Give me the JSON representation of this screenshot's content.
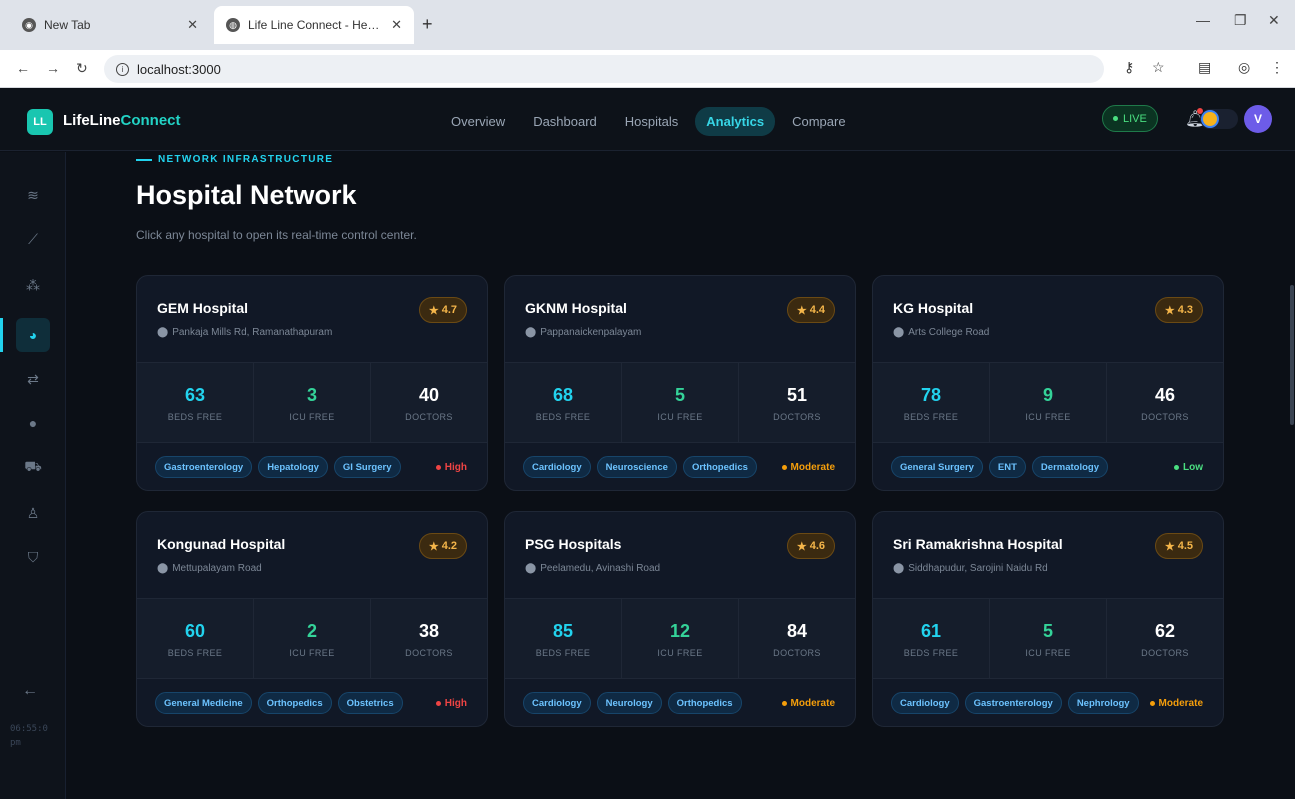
{
  "browser": {
    "tabs": [
      {
        "title": "New Tab",
        "active": false
      },
      {
        "title": "Life Line Connect - Healthcare I",
        "active": true
      }
    ],
    "url": "localhost:3000"
  },
  "app": {
    "logo_text": "LL",
    "brand_main": "LifeLine",
    "brand_accent": "Connect",
    "nav": [
      {
        "label": "Overview",
        "active": false
      },
      {
        "label": "Dashboard",
        "active": false
      },
      {
        "label": "Hospitals",
        "active": false
      },
      {
        "label": "Analytics",
        "active": true
      },
      {
        "label": "Compare",
        "active": false
      }
    ],
    "live_label": "LIVE",
    "avatar_initial": "V",
    "accent_color": "#22d3ee"
  },
  "sidebar": {
    "items": [
      {
        "icon": "layers-icon",
        "glyph": "≋",
        "active": false
      },
      {
        "icon": "trend-chart-icon",
        "glyph": "⟋",
        "active": false
      },
      {
        "icon": "people-group-icon",
        "glyph": "⁂",
        "active": false
      },
      {
        "icon": "pie-chart-icon",
        "glyph": "◕",
        "active": true
      },
      {
        "icon": "compare-arrows-icon",
        "glyph": "⇄",
        "active": false
      },
      {
        "icon": "blood-drop-icon",
        "glyph": "●",
        "active": false
      },
      {
        "icon": "ambulance-icon",
        "glyph": "⛟",
        "active": false
      },
      {
        "icon": "doctor-icon",
        "glyph": "♙",
        "active": false
      },
      {
        "icon": "shield-icon",
        "glyph": "⛉",
        "active": false
      }
    ],
    "clock_text": "06:55:0 pm"
  },
  "page": {
    "eyebrow": "NETWORK INFRASTRUCTURE",
    "title": "Hospital Network",
    "subtitle": "Click any hospital to open its real-time control center."
  },
  "labels": {
    "beds": "BEDS FREE",
    "icu": "ICU FREE",
    "doctors": "DOCTORS"
  },
  "load_colors": {
    "High": "#ef4444",
    "Moderate": "#f59e0b",
    "Low": "#4ade80"
  },
  "hospitals": [
    {
      "name": "GEM Hospital",
      "address": "Pankaja Mills Rd, Ramanathapuram",
      "rating": "4.7",
      "beds": "63",
      "icu": "3",
      "doctors": "40",
      "tags": [
        "Gastroenterology",
        "Hepatology",
        "GI Surgery"
      ],
      "load": "High"
    },
    {
      "name": "GKNM Hospital",
      "address": "Pappanaickenpalayam",
      "rating": "4.4",
      "beds": "68",
      "icu": "5",
      "doctors": "51",
      "tags": [
        "Cardiology",
        "Neuroscience",
        "Orthopedics"
      ],
      "load": "Moderate"
    },
    {
      "name": "KG Hospital",
      "address": "Arts College Road",
      "rating": "4.3",
      "beds": "78",
      "icu": "9",
      "doctors": "46",
      "tags": [
        "General Surgery",
        "ENT",
        "Dermatology"
      ],
      "load": "Low"
    },
    {
      "name": "Kongunad Hospital",
      "address": "Mettupalayam Road",
      "rating": "4.2",
      "beds": "60",
      "icu": "2",
      "doctors": "38",
      "tags": [
        "General Medicine",
        "Orthopedics",
        "Obstetrics"
      ],
      "load": "High"
    },
    {
      "name": "PSG Hospitals",
      "address": "Peelamedu, Avinashi Road",
      "rating": "4.6",
      "beds": "85",
      "icu": "12",
      "doctors": "84",
      "tags": [
        "Cardiology",
        "Neurology",
        "Orthopedics"
      ],
      "load": "Moderate"
    },
    {
      "name": "Sri Ramakrishna Hospital",
      "address": "Siddhapudur, Sarojini Naidu Rd",
      "rating": "4.5",
      "beds": "61",
      "icu": "5",
      "doctors": "62",
      "tags": [
        "Cardiology",
        "Gastroenterology",
        "Nephrology"
      ],
      "load": "Moderate"
    }
  ]
}
